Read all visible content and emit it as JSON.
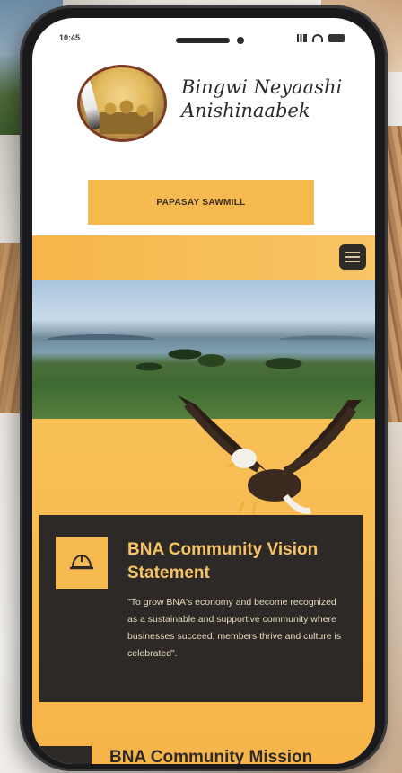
{
  "status_bar": {
    "time": "10:45"
  },
  "header": {
    "site_title_line1": "Bingwi Neyaashi",
    "site_title_line2": "Anishinaabek"
  },
  "cta": {
    "label": "PAPASAY SAWMILL"
  },
  "nav": {
    "menu_icon": "hamburger-menu-icon"
  },
  "vision": {
    "icon": "hard-hat-icon",
    "title_line1": "BNA Community Vision",
    "title_line2": "Statement",
    "text": "\"To grow BNA's economy and become recognized as a sustainable and supportive community where businesses succeed, members thrive and culture is celebrated\"."
  },
  "mission": {
    "title": "BNA Community Mission"
  },
  "colors": {
    "accent": "#f6b94f",
    "card_dark": "#2c2926",
    "card_title": "#f6c366"
  }
}
